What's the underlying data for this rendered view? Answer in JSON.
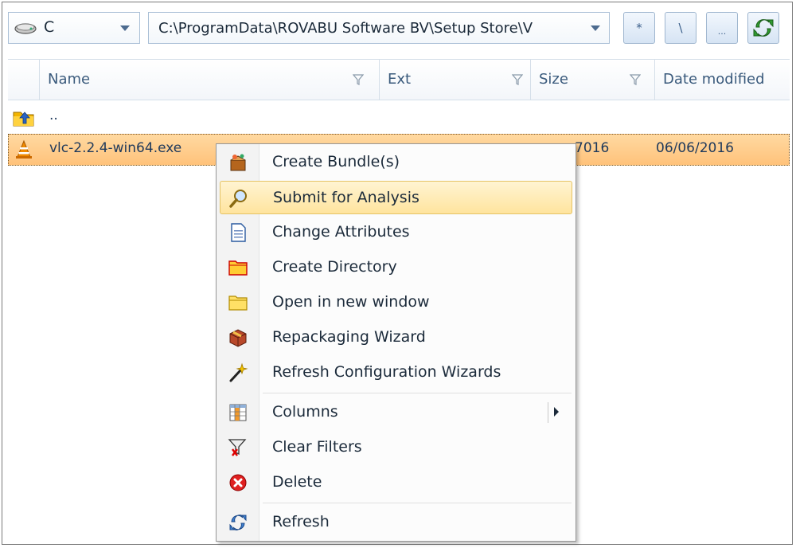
{
  "toolbar": {
    "drive_label": "C",
    "drive_icon": "drive-icon",
    "path": "C:\\ProgramData\\ROVABU Software BV\\Setup Store\\V",
    "buttons": [
      {
        "label": "*"
      },
      {
        "label": "\\"
      },
      {
        "label": "..."
      },
      {
        "icon": "refresh-icon"
      }
    ]
  },
  "columns": [
    {
      "label": "Name"
    },
    {
      "label": "Ext"
    },
    {
      "label": "Size"
    },
    {
      "label": "Date modified"
    }
  ],
  "rows": [
    {
      "name": "..",
      "icon": "folder-up-icon"
    },
    {
      "name": "vlc-2.2.4-win64.exe",
      "size_partial": "7016",
      "date": "06/06/2016",
      "icon": "vlc-icon",
      "selected": true
    }
  ],
  "context_menu": {
    "items": [
      {
        "label": "Create Bundle(s)",
        "icon": "bundle-icon"
      },
      {
        "label": "Submit for Analysis",
        "icon": "magnifier-icon",
        "highlighted": true
      },
      {
        "label": "Change Attributes",
        "icon": "document-icon"
      },
      {
        "label": "Create Directory",
        "icon": "folder-new-icon"
      },
      {
        "label": "Open in new window",
        "icon": "folder-open-icon"
      },
      {
        "label": "Repackaging Wizard",
        "icon": "box-icon"
      },
      {
        "label": "Refresh Configuration Wizards",
        "icon": "wand-icon"
      },
      {
        "label": "Columns",
        "icon": "columns-icon",
        "has_submenu": true
      },
      {
        "label": "Clear Filters",
        "icon": "clear-filter-icon"
      },
      {
        "label": "Delete",
        "icon": "delete-icon"
      },
      {
        "label": "Refresh",
        "icon": "refresh-icon"
      }
    ]
  },
  "colors": {
    "selection": "#ffc27a",
    "menu_highlight": "#ffe49e",
    "header_text": "#3a5a7c"
  }
}
